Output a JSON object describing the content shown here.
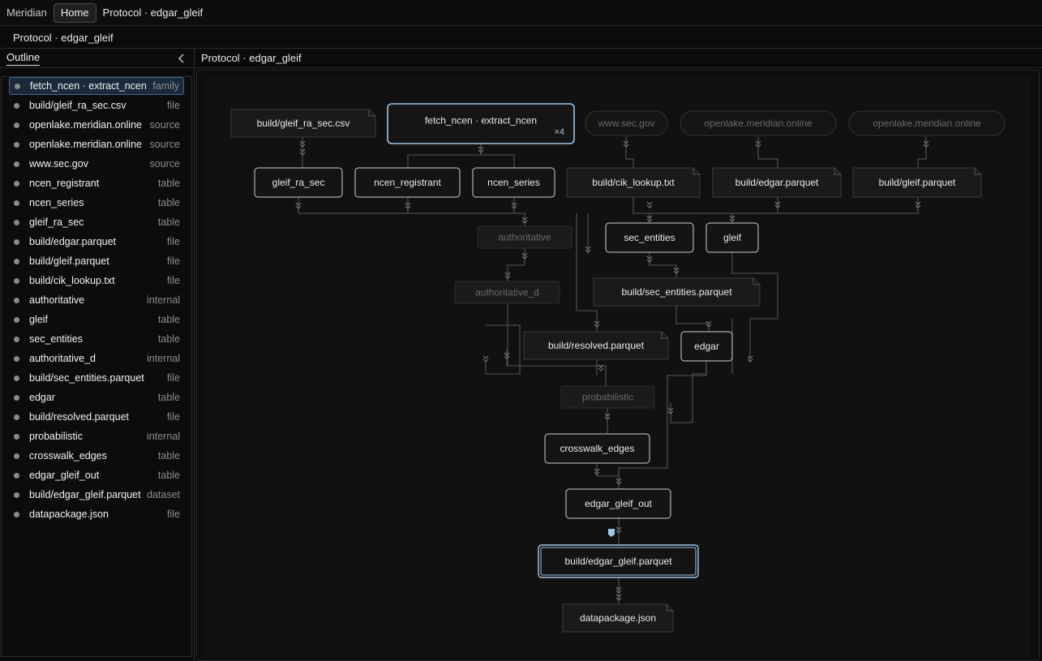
{
  "app": {
    "brand": "Meridian",
    "home_label": "Home",
    "title": "Protocol · edgar_gleif"
  },
  "breadcrumb": "Protocol · edgar_gleif",
  "sidebar": {
    "tab_label": "Outline",
    "collapse_icon": "chevron-left-icon",
    "items": [
      {
        "label": "fetch_ncen · extract_ncen",
        "kind": "family",
        "selected": true
      },
      {
        "label": "build/gleif_ra_sec.csv",
        "kind": "file"
      },
      {
        "label": "openlake.meridian.online",
        "kind": "source"
      },
      {
        "label": "openlake.meridian.online",
        "kind": "source"
      },
      {
        "label": "www.sec.gov",
        "kind": "source"
      },
      {
        "label": "ncen_registrant",
        "kind": "table"
      },
      {
        "label": "ncen_series",
        "kind": "table"
      },
      {
        "label": "gleif_ra_sec",
        "kind": "table"
      },
      {
        "label": "build/edgar.parquet",
        "kind": "file"
      },
      {
        "label": "build/gleif.parquet",
        "kind": "file"
      },
      {
        "label": "build/cik_lookup.txt",
        "kind": "file"
      },
      {
        "label": "authoritative",
        "kind": "internal"
      },
      {
        "label": "gleif",
        "kind": "table"
      },
      {
        "label": "sec_entities",
        "kind": "table"
      },
      {
        "label": "authoritative_d",
        "kind": "internal"
      },
      {
        "label": "build/sec_entities.parquet",
        "kind": "file"
      },
      {
        "label": "edgar",
        "kind": "table"
      },
      {
        "label": "build/resolved.parquet",
        "kind": "file"
      },
      {
        "label": "probabilistic",
        "kind": "internal"
      },
      {
        "label": "crosswalk_edges",
        "kind": "table"
      },
      {
        "label": "edgar_gleif_out",
        "kind": "table"
      },
      {
        "label": "build/edgar_gleif.parquet",
        "kind": "dataset"
      },
      {
        "label": "datapackage.json",
        "kind": "file"
      }
    ]
  },
  "main": {
    "title": "Protocol · edgar_gleif",
    "graph": {
      "colors": {
        "edge": "#4a4a4a",
        "node_border": "#d0d0d0",
        "selected_border": "#9ec6e6",
        "dim_text": "#6a6a6a"
      },
      "nodes": {
        "n_gleif_csv": {
          "label": "build/gleif_ra_sec.csv",
          "type": "file"
        },
        "n_family": {
          "label": "fetch_ncen · extract_ncen",
          "type": "family",
          "badge": "×4"
        },
        "n_sec_gov": {
          "label": "www.sec.gov",
          "type": "source"
        },
        "n_openlake1": {
          "label": "openlake.meridian.online",
          "type": "source"
        },
        "n_openlake2": {
          "label": "openlake.meridian.online",
          "type": "source"
        },
        "n_gleif_ra_sec": {
          "label": "gleif_ra_sec",
          "type": "table"
        },
        "n_ncen_registrant": {
          "label": "ncen_registrant",
          "type": "table"
        },
        "n_ncen_series": {
          "label": "ncen_series",
          "type": "table"
        },
        "n_cik": {
          "label": "build/cik_lookup.txt",
          "type": "file"
        },
        "n_edgar_parquet": {
          "label": "build/edgar.parquet",
          "type": "file"
        },
        "n_gleif_parquet": {
          "label": "build/gleif.parquet",
          "type": "file"
        },
        "n_authoritative": {
          "label": "authoritative",
          "type": "internal"
        },
        "n_sec_entities": {
          "label": "sec_entities",
          "type": "table"
        },
        "n_gleif": {
          "label": "gleif",
          "type": "table"
        },
        "n_authoritative_d": {
          "label": "authoritative_d",
          "type": "internal"
        },
        "n_sec_entities_parquet": {
          "label": "build/sec_entities.parquet",
          "type": "file"
        },
        "n_resolved": {
          "label": "build/resolved.parquet",
          "type": "file"
        },
        "n_edgar": {
          "label": "edgar",
          "type": "table"
        },
        "n_probabilistic": {
          "label": "probabilistic",
          "type": "internal"
        },
        "n_crosswalk": {
          "label": "crosswalk_edges",
          "type": "table"
        },
        "n_edgar_gleif_out": {
          "label": "edgar_gleif_out",
          "type": "table"
        },
        "n_edgar_gleif_parquet": {
          "label": "build/edgar_gleif.parquet",
          "type": "dataset"
        },
        "n_datapackage": {
          "label": "datapackage.json",
          "type": "file"
        }
      }
    }
  }
}
